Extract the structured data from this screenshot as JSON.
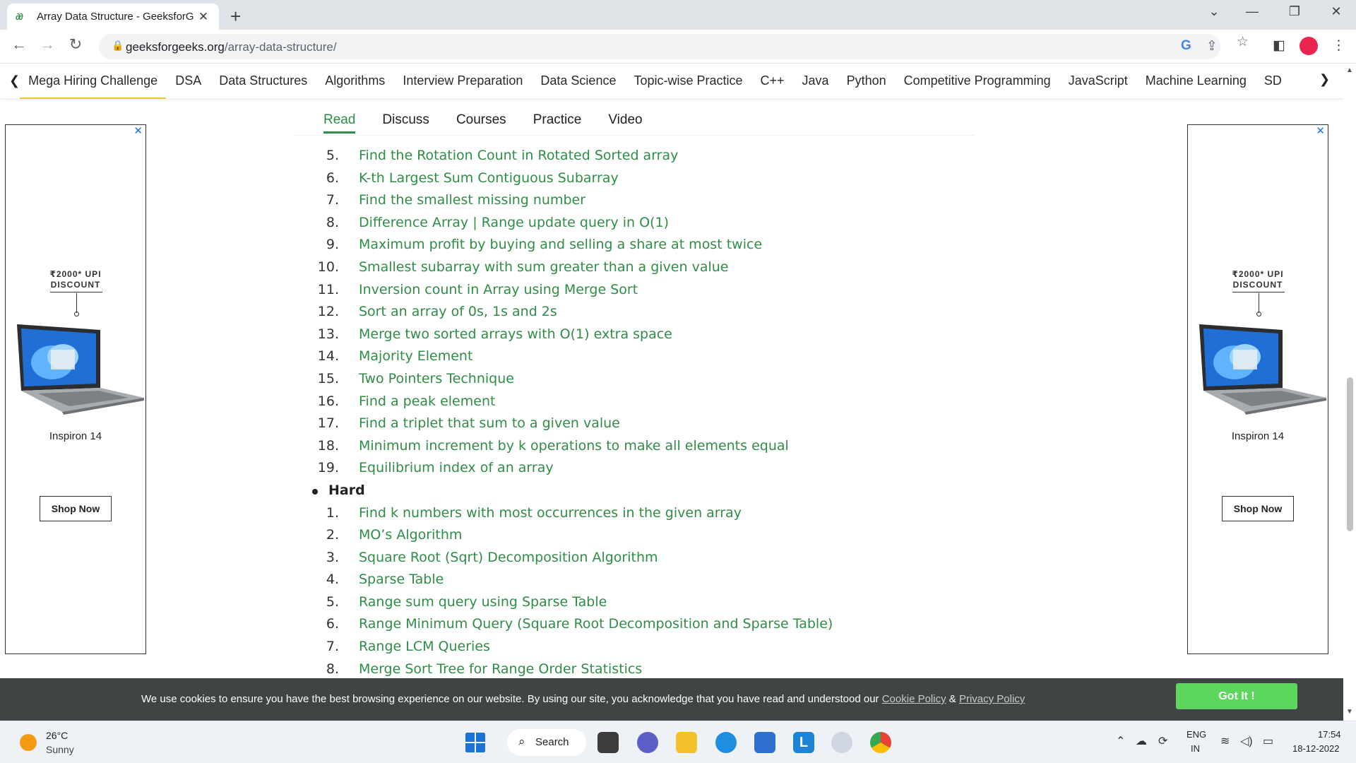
{
  "browser": {
    "tab_title": "Array Data Structure - GeeksforG",
    "url_domain": "geeksforgeeks.org",
    "url_path": "/array-data-structure/"
  },
  "nav": {
    "items": [
      "Mega Hiring Challenge",
      "DSA",
      "Data Structures",
      "Algorithms",
      "Interview Preparation",
      "Data Science",
      "Topic-wise Practice",
      "C++",
      "Java",
      "Python",
      "Competitive Programming",
      "JavaScript",
      "Machine Learning",
      "SD"
    ]
  },
  "subtabs": [
    "Read",
    "Discuss",
    "Courses",
    "Practice",
    "Video"
  ],
  "content": {
    "medium_items": [
      {
        "num": "5.",
        "text": "Find the Rotation Count in Rotated Sorted array"
      },
      {
        "num": "6.",
        "text": "K-th Largest Sum Contiguous Subarray"
      },
      {
        "num": "7.",
        "text": "Find the smallest missing number"
      },
      {
        "num": "8.",
        "text": "Difference Array | Range update query in O(1)"
      },
      {
        "num": "9.",
        "text": "Maximum profit by buying and selling a share at most twice"
      },
      {
        "num": "10.",
        "text": "Smallest subarray with sum greater than a given value"
      },
      {
        "num": "11.",
        "text": "Inversion count in Array using Merge Sort"
      },
      {
        "num": "12.",
        "text": "Sort an array of 0s, 1s and 2s"
      },
      {
        "num": "13.",
        "text": "Merge two sorted arrays with O(1) extra space"
      },
      {
        "num": "14.",
        "text": "Majority Element"
      },
      {
        "num": "15.",
        "text": "Two Pointers Technique"
      },
      {
        "num": "16.",
        "text": "Find a peak element"
      },
      {
        "num": "17.",
        "text": "Find a triplet that sum to a given value"
      },
      {
        "num": "18.",
        "text": "Minimum increment by k operations to make all elements equal"
      },
      {
        "num": "19.",
        "text": "Equilibrium index of an array"
      }
    ],
    "hard_heading": "Hard",
    "hard_items": [
      {
        "num": "1.",
        "text": "Find k numbers with most occurrences in the given array"
      },
      {
        "num": "2.",
        "text": "MO’s Algorithm"
      },
      {
        "num": "3.",
        "text": "Square Root (Sqrt) Decomposition Algorithm"
      },
      {
        "num": "4.",
        "text": "Sparse Table"
      },
      {
        "num": "5.",
        "text": "Range sum query using Sparse Table"
      },
      {
        "num": "6.",
        "text": "Range Minimum Query (Square Root Decomposition and Sparse Table)"
      },
      {
        "num": "7.",
        "text": "Range LCM Queries"
      },
      {
        "num": "8.",
        "text": "Merge Sort Tree for Range Order Statistics"
      }
    ]
  },
  "ad": {
    "discount": "₹2000* UPI DISCOUNT",
    "product": "Inspiron 14",
    "button": "Shop Now",
    "close": "✕"
  },
  "cookie": {
    "text": "We use cookies to ensure you have the best browsing experience on our website. By using our site, you acknowledge that you have read and understood our ",
    "cookie_policy": "Cookie Policy",
    "amp": " & ",
    "privacy_policy": "Privacy Policy",
    "button": "Got It !"
  },
  "taskbar": {
    "temp": "26°C",
    "condition": "Sunny",
    "search": "Search",
    "lang_top": "ENG",
    "lang_bottom": "IN",
    "time": "17:54",
    "date": "18-12-2022"
  }
}
